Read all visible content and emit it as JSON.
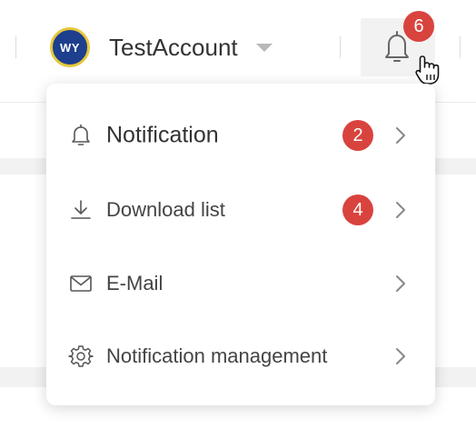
{
  "header": {
    "avatar_initials": "WY",
    "account_name": "TestAccount",
    "notification_count": "6"
  },
  "menu": {
    "items": [
      {
        "label": "Notification",
        "badge": "2",
        "icon": "bell-icon"
      },
      {
        "label": "Download list",
        "badge": "4",
        "icon": "download-icon"
      },
      {
        "label": "E-Mail",
        "badge": "",
        "icon": "mail-icon"
      },
      {
        "label": "Notification management",
        "badge": "",
        "icon": "gear-icon"
      }
    ]
  },
  "colors": {
    "badge": "#d9433e",
    "avatar": "#1d3f8e",
    "avatar_ring": "#e6c73a",
    "text": "#444444"
  }
}
